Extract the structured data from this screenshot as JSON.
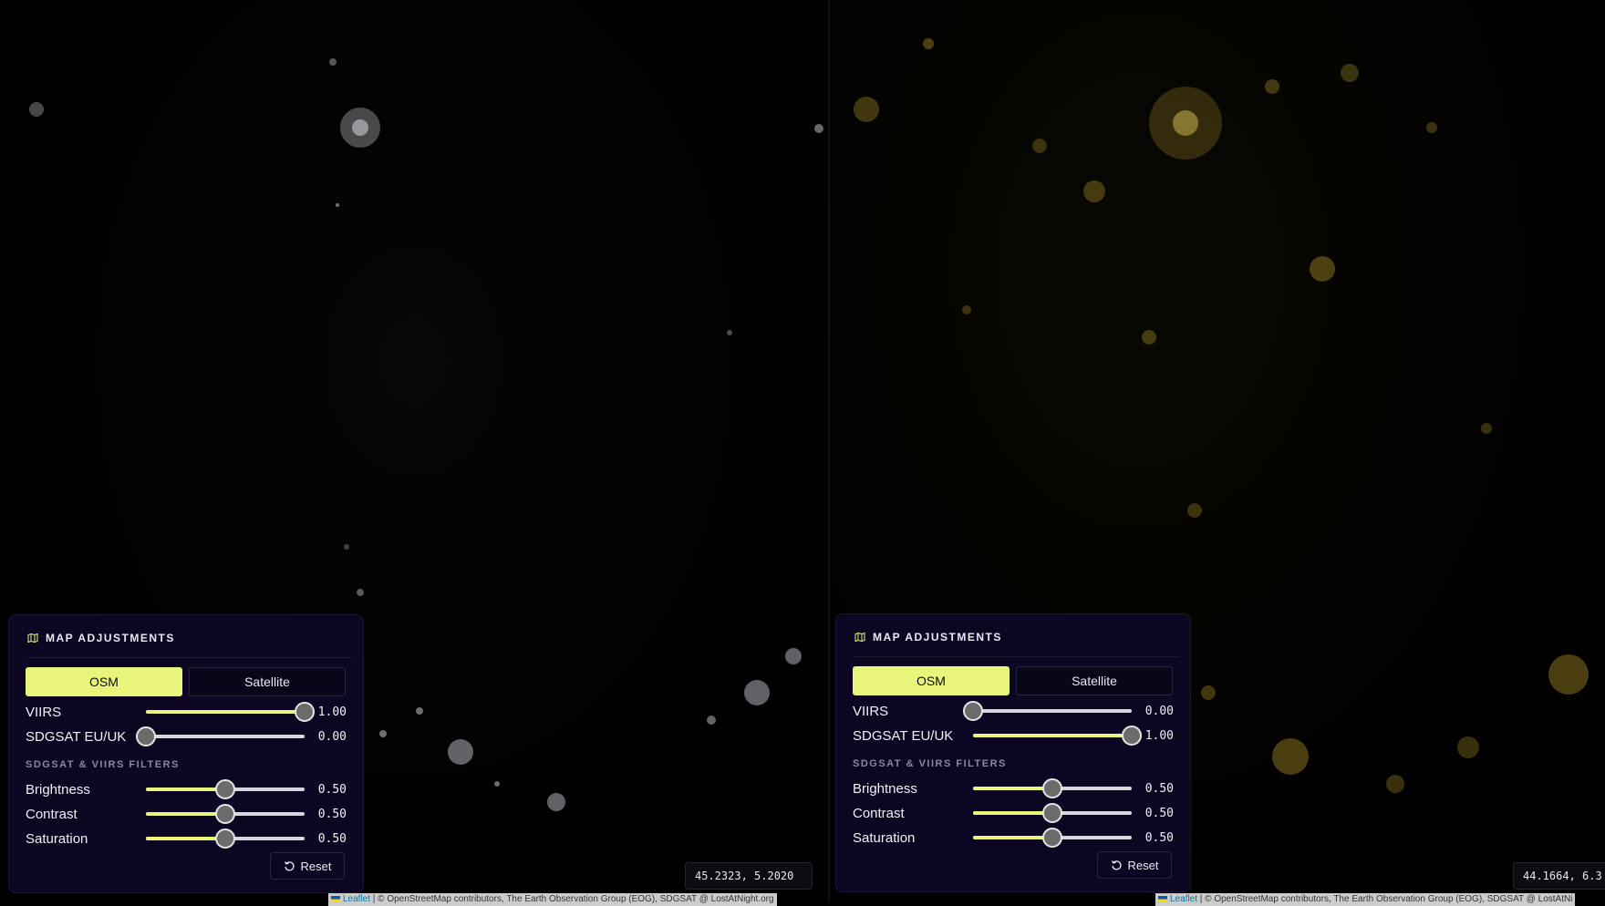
{
  "panes": [
    {
      "panel": {
        "title": "MAP ADJUSTMENTS",
        "icon": "map-icon",
        "basemap_options": [
          "OSM",
          "Satellite"
        ],
        "basemap_selected": "OSM",
        "layers": [
          {
            "label": "VIIRS",
            "value": 1.0,
            "display": "1.00"
          },
          {
            "label": "SDGSAT EU/UK",
            "value": 0.0,
            "display": "0.00"
          }
        ],
        "filters_heading": "SDGSAT & VIIRS FILTERS",
        "filters": [
          {
            "label": "Brightness",
            "value": 0.5,
            "display": "0.50"
          },
          {
            "label": "Contrast",
            "value": 0.5,
            "display": "0.50"
          },
          {
            "label": "Saturation",
            "value": 0.5,
            "display": "0.50"
          }
        ],
        "reset_label": "Reset"
      },
      "coordinates": "45.2323, 5.2020",
      "attribution": {
        "leaflet": "Leaflet",
        "text": " | © OpenStreetMap contributors, The Earth Observation Group (EOG), SDGSAT @ LostAtNight.org"
      }
    },
    {
      "panel": {
        "title": "MAP ADJUSTMENTS",
        "icon": "map-icon",
        "basemap_options": [
          "OSM",
          "Satellite"
        ],
        "basemap_selected": "OSM",
        "layers": [
          {
            "label": "VIIRS",
            "value": 0.0,
            "display": "0.00"
          },
          {
            "label": "SDGSAT EU/UK",
            "value": 1.0,
            "display": "1.00"
          }
        ],
        "filters_heading": "SDGSAT & VIIRS FILTERS",
        "filters": [
          {
            "label": "Brightness",
            "value": 0.5,
            "display": "0.50"
          },
          {
            "label": "Contrast",
            "value": 0.5,
            "display": "0.50"
          },
          {
            "label": "Saturation",
            "value": 0.5,
            "display": "0.50"
          }
        ],
        "reset_label": "Reset"
      },
      "coordinates": "44.1664, 6.3",
      "attribution": {
        "leaflet": "Leaflet",
        "text": " | © OpenStreetMap contributors, The Earth Observation Group (EOG), SDGSAT @ LostAtNi"
      }
    }
  ],
  "colors": {
    "accent": "#e8f57a",
    "panel_bg": "#0c0622",
    "viirs_lights": "#d8d8e6",
    "sdgsat_lights": "#b89a2a"
  }
}
